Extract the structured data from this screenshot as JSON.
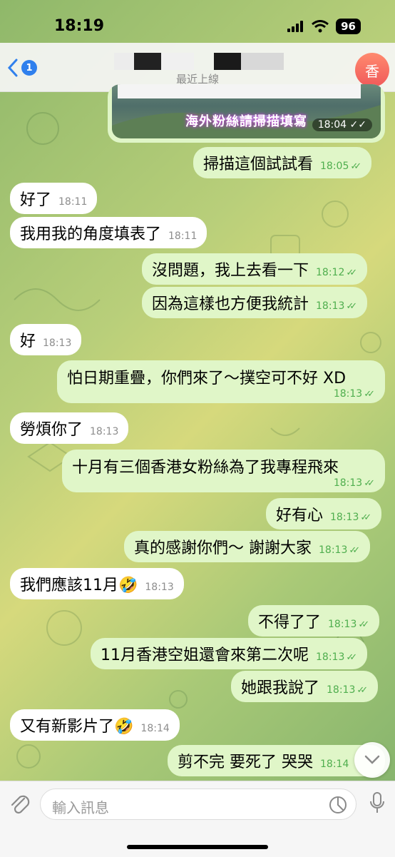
{
  "status": {
    "time": "18:19",
    "battery": "96"
  },
  "header": {
    "back_badge": "1",
    "last_seen": "最近上線",
    "avatar_letter": "香"
  },
  "media": {
    "caption": "海外粉絲請掃描填寫",
    "time": "18:04"
  },
  "messages": [
    {
      "dir": "out",
      "text": "掃描這個試試看",
      "time": "18:05"
    },
    {
      "dir": "in",
      "text": "好了",
      "time": "18:11"
    },
    {
      "dir": "in",
      "text": "我用我的角度填表了",
      "time": "18:11"
    },
    {
      "dir": "out",
      "text": "沒問題，我上去看一下",
      "time": "18:12"
    },
    {
      "dir": "out",
      "text": "因為這樣也方便我統計",
      "time": "18:13"
    },
    {
      "dir": "in",
      "text": "好",
      "time": "18:13"
    },
    {
      "dir": "out",
      "text": "怕日期重疊，你們來了～撲空可不好 XD",
      "time": "18:13"
    },
    {
      "dir": "in",
      "text": "勞煩你了",
      "time": "18:13"
    },
    {
      "dir": "out",
      "text": "十月有三個香港女粉絲為了我專程飛來",
      "time": "18:13"
    },
    {
      "dir": "out",
      "text": "好有心",
      "time": "18:13"
    },
    {
      "dir": "out",
      "text": "真的感謝你們～ 謝謝大家",
      "time": "18:13"
    },
    {
      "dir": "in",
      "text": "我們應該11月🤣",
      "time": "18:13"
    },
    {
      "dir": "out",
      "text": "不得了了",
      "time": "18:13"
    },
    {
      "dir": "out",
      "text": "11月香港空姐還會來第二次呢",
      "time": "18:13"
    },
    {
      "dir": "out",
      "text": "她跟我說了",
      "time": "18:13"
    },
    {
      "dir": "in",
      "text": "又有新影片了🤣",
      "time": "18:14"
    },
    {
      "dir": "out",
      "text": "剪不完 要死了 哭哭",
      "time": "18:14"
    }
  ],
  "composer": {
    "placeholder": "輸入訊息"
  },
  "colors": {
    "accent": "#2f80ed",
    "outgoing_bubble": "#e0f6c8",
    "incoming_bubble": "#ffffff",
    "check": "#4fae4e"
  },
  "icons": [
    "back-chevron-icon",
    "signal-icon",
    "wifi-icon",
    "battery-icon",
    "double-check-icon",
    "chevron-down-icon",
    "paperclip-icon",
    "sticker-icon",
    "mic-icon"
  ]
}
